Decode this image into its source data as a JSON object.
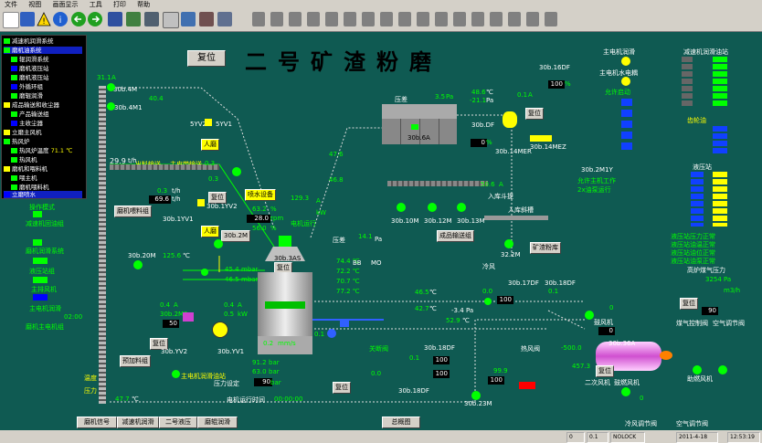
{
  "menu": [
    "文件",
    "视图",
    "画面显示",
    "工具",
    "打印",
    "帮助"
  ],
  "title": "二号矿渣粉磨",
  "reset_top": "复位",
  "nav": [
    {
      "label": "减速机润滑系统",
      "color": "#00ff00"
    },
    {
      "label": "磨机油系统",
      "color": "#00ff00"
    },
    {
      "label": "辊润滑系统",
      "color": "#00ff00"
    },
    {
      "label": "磨机液压站",
      "color": "#0000ff"
    },
    {
      "label": "磨机液压站",
      "color": "#00ff00"
    },
    {
      "label": "外循环组",
      "color": "#0000ff"
    },
    {
      "label": "磨辊润滑",
      "color": "#00ff00"
    },
    {
      "label": "成品输送和收尘器",
      "color": "#ffff00"
    },
    {
      "label": "产品输送组",
      "color": "#00ff00"
    },
    {
      "label": "主收尘器",
      "color": "#0000ff"
    },
    {
      "label": "立磨主风机",
      "color": "#ffff00"
    },
    {
      "label": "热风炉",
      "color": "#00ff00"
    },
    {
      "label": "热风炉温度",
      "color": "#00ff00",
      "value": "71.1 ℃"
    },
    {
      "label": "热风机",
      "color": "#00ff00"
    },
    {
      "label": "磨机和喂料机",
      "color": "#ffff00"
    },
    {
      "label": "喂主机",
      "color": "#00ff00"
    },
    {
      "label": "磨机喂料机",
      "color": "#00ff00"
    },
    {
      "label": "立磨喷水",
      "color": "#0000ff"
    }
  ],
  "left_status": [
    {
      "label": "操作模式",
      "val": ""
    },
    {
      "label": "减速机回油组",
      "val": ""
    },
    {
      "label": "磨机润滑系统",
      "val": ""
    },
    {
      "label": "液压站组",
      "val": ""
    },
    {
      "label": "主排风机",
      "val": ""
    },
    {
      "label": "主电机润滑",
      "val": "02:00"
    },
    {
      "label": "磨机主电机组",
      "val": ""
    }
  ],
  "tags": {
    "t_4m": "30b.4M",
    "t_4m_val": "31.1",
    "t_4m1": "30b.4M1",
    "t_4m1_val": "40.4",
    "t_5yv2": "5YV2",
    "t_5yv1": "5YV1",
    "renzhong": "人磨",
    "t_298": "29.9",
    "t_298u": "t/h",
    "feed_a": "出料输送",
    "feed_b": "主皮带输送",
    "t_03a": "0.3",
    "t_03b": "0.3",
    "t_03th": "0.3",
    "t_696": "69.6",
    "t_th": "t/h",
    "reset1": "复位",
    "t_1yv2": "30b.1YV2",
    "t_1yv1": "30b.1YV1",
    "feed_grp": "磨机喂料组",
    "t_2m": "30b.2M",
    "renmo2": "人磨",
    "t_2m_b": "30b.2M",
    "water_run": "喷水设备",
    "t_63": "63.2",
    "t_28": "28.0",
    "t_560": "56.0",
    "t_1293": "129.3",
    "kw": "kW",
    "rpm": "rpm",
    "pct": "%",
    "t_ampere": "A",
    "motor_run": "电机运行",
    "pressure": "压差",
    "pa": "Pa",
    "t_35": "3.5",
    "t_476": "47.6",
    "t_468": "46.8",
    "t_pa": "Pa",
    "t_141": "14.1",
    "t_6a": "30b.6A",
    "t_3as": "30b.3AS",
    "jiaxian": "复位",
    "t_20m": "30b.20M",
    "t_1257": "125.6",
    "t_454": "45.4",
    "t_465": "46.5",
    "mbar": "mbar",
    "temps": [
      "74.4 ℃",
      "72.2 ℃",
      "70.7 ℃",
      "77.2 ℃"
    ],
    "bb": "BB",
    "mo": "MO",
    "t_04a": "0.4",
    "t_05kw": "0.5",
    "t_04b": "0.4",
    "t_02ma": "0.2",
    "t_mms": "mm/s",
    "t_02m2": "30b.2M2",
    "t_50": "50",
    "t_91": "91.2",
    "t_630": "63.0",
    "bar": "bar",
    "press_set": "压力设定",
    "t_90": "90",
    "motor_time": "电机运行时间",
    "time_val": "00:00:00",
    "t_yv2": "30b.YV2",
    "t_yv1": "30b.YV1",
    "reset2": "复位",
    "pre_grp": "预加料组",
    "lube": "主电机润滑油站",
    "t_477": "47.7",
    "temp_lbl": "温度",
    "press_lbl": "压力",
    "ff": "风机",
    "t_19df": "30b.19DF",
    "t_1df": "30b.1DF",
    "t_486": "48.6",
    "t_211": "-21.1",
    "t_01a": "0.1",
    "t_ddf": "30b.DF",
    "reset3": "复位",
    "t_14mer": "30b.14MER",
    "t_14mez": "30b.14MEZ",
    "t_506": "50.6",
    "t_506a": "A",
    "incoming": "入库斗提",
    "t_10m": "30b.10M",
    "t_12m": "30b.12M",
    "t_13m": "30b.13M",
    "product_grp": "成品输送组",
    "inlet": "入库斜槽",
    "t_322m": "32.2M",
    "slag_bin": "矿渣粉库",
    "cold_air": "冷风",
    "t_17df": "30b.17DF",
    "t_18df": "30b.18DF",
    "t_00a": "0.0",
    "t_465b": "46.5",
    "t_427": "42.7",
    "t_34": "-3.4",
    "t_529": "52.9",
    "t_18df2": "30b.18DF",
    "t_01b": "0.1",
    "t_100": "100",
    "t_100b": "100",
    "t_100c": "100",
    "t_999": "99.9",
    "t_16df": "30b.16DF",
    "t_23m": "30b.23M",
    "hot_valve": "热风阀",
    "t_5000": "-500.0",
    "t_4573": "457.3",
    "t_36a": "30b.36A",
    "exit_valve": "出口阀",
    "t_100d": "100",
    "t_pct": "%",
    "t_0pct": "0",
    "reset4": "复位",
    "reset5": "复位",
    "eto": "出口",
    "rawfan": "鼓风机",
    "t_gas": "高炉煤气压力",
    "t_gasv": "3254",
    "t_gasu": "Pa",
    "t_m3": "m3/h",
    "reset6": "复位",
    "t_90b": "90",
    "gas_ctrl": "煤气控制阀",
    "air_ctrl": "空气调节阀",
    "fan2": "二次风机",
    "fan3": "助燃风机",
    "fan4": "鼓燃风机",
    "cold_reg": "冷风调节阀",
    "air_reg": "空气调节阀",
    "t_0p1": "0",
    "t_0p2": "0",
    "t_0p3": "0",
    "stop_off": "关断阀",
    "main_motor": "主电机润滑",
    "main_water": "主电机水电耦",
    "allow": "允许启动",
    "main_status": "30b.2M1Y",
    "main_status2": "允许主机工作",
    "run2": "2x油泵运行",
    "reducer": "减速机润滑油站",
    "gearbox": "齿轮油",
    "pressure_st": "液压站",
    "sv_labels": [
      "主电机水电耦",
      "允许启动"
    ],
    "red_list": [
      "33H1",
      "33H2",
      "33H3",
      "33H4",
      "33H5",
      "33H6",
      "33H7"
    ],
    "hyd_list": [
      "35H1",
      "35H2",
      "35H3",
      "35H4",
      "35H5",
      "35H6",
      "35H7",
      "35H8"
    ],
    "checks": [
      "液压站压力正常",
      "液压站油温正常",
      "液压站油位正常",
      "液压站油泵正常"
    ]
  },
  "bottom_buttons": [
    "磨机信号",
    "减速机润滑",
    "二号液压",
    "磨辊润滑",
    "总概图"
  ],
  "status": {
    "s1": "0",
    "s2": "0.1",
    "s3": "NOLOCK",
    "s4": "2011-4-18",
    "s5": "12:53:19"
  },
  "colors": {
    "bg": "#0f5a52",
    "green": "#00ff00",
    "yellow": "#ffff00",
    "blue": "#0000ff",
    "red": "#ff0000"
  }
}
